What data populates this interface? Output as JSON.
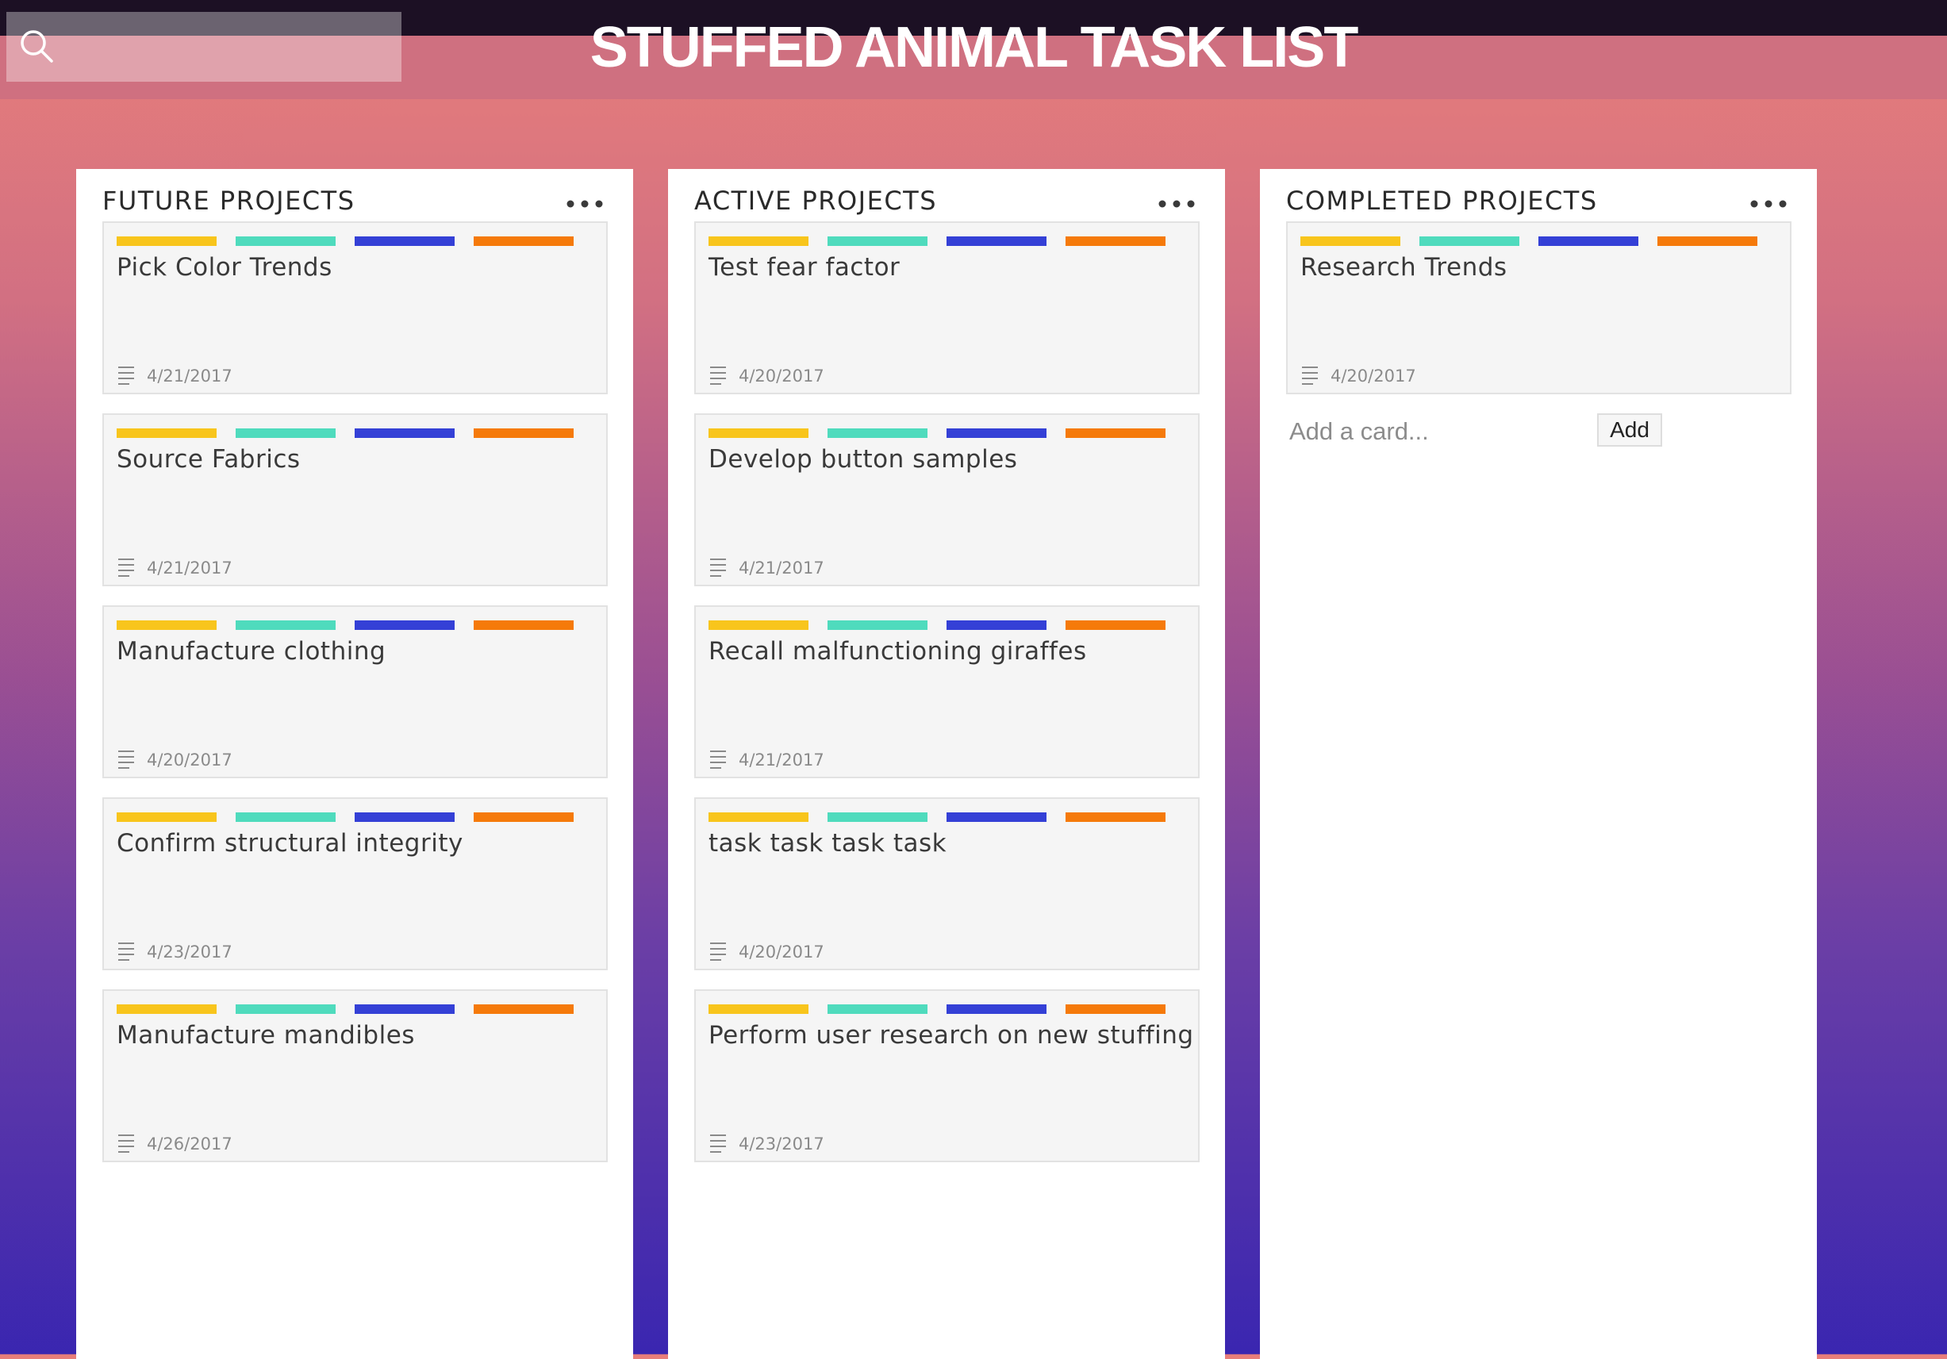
{
  "header": {
    "title": "STUFFED ANIMAL TASK LIST",
    "search": {
      "value": "",
      "placeholder": ""
    }
  },
  "label_colors": [
    "#f8c51c",
    "#4fdbbd",
    "#3440d6",
    "#f57a0a"
  ],
  "icons": {
    "search": "search-icon",
    "list_menu": "ellipsis-icon",
    "description": "description-icon"
  },
  "lists": [
    {
      "title": "FUTURE PROJECTS",
      "cards": [
        {
          "title": "Pick Color Trends",
          "date": "4/21/2017"
        },
        {
          "title": "Source Fabrics",
          "date": "4/21/2017"
        },
        {
          "title": "Manufacture clothing",
          "date": "4/20/2017"
        },
        {
          "title": "Confirm structural integrity",
          "date": "4/23/2017"
        },
        {
          "title": "Manufacture mandibles",
          "date": "4/26/2017"
        }
      ]
    },
    {
      "title": "ACTIVE PROJECTS",
      "cards": [
        {
          "title": "Test fear factor",
          "date": "4/20/2017"
        },
        {
          "title": "Develop button samples",
          "date": "4/21/2017"
        },
        {
          "title": "Recall malfunctioning giraffes",
          "date": "4/21/2017"
        },
        {
          "title": "task task task task",
          "date": "4/20/2017"
        },
        {
          "title": "Perform user research on new stuffing",
          "date": "4/23/2017"
        }
      ]
    },
    {
      "title": "COMPLETED PROJECTS",
      "cards": [
        {
          "title": "Research Trends",
          "date": "4/20/2017"
        }
      ],
      "add_card": {
        "placeholder": "Add a card...",
        "button_label": "Add"
      }
    }
  ]
}
